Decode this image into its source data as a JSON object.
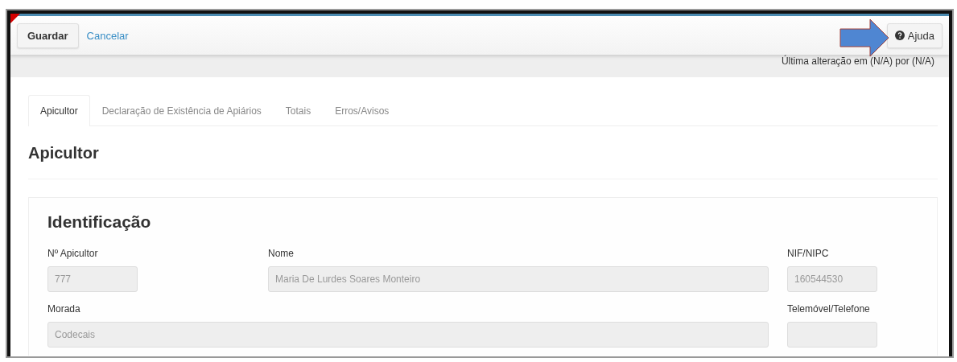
{
  "toolbar": {
    "buttons": [
      {
        "label": "Guardar",
        "kind": "button"
      },
      {
        "label": "Cancelar",
        "kind": "link"
      }
    ],
    "help": {
      "label": "Ajuda"
    }
  },
  "last_change": "Última alteração em (N/A) por (N/A)",
  "tabs": [
    {
      "label": "Apicultor",
      "selected": true
    },
    {
      "label": "Declaração de Existência de Apiários",
      "selected": false
    },
    {
      "label": "Totais",
      "selected": false
    },
    {
      "label": "Erros/Avisos",
      "selected": false
    }
  ],
  "page_title": "Apicultor",
  "section": {
    "title": "Identificação",
    "fields": [
      {
        "label": "Nº Apicultor",
        "value": "777",
        "disabled": true,
        "kind": "short"
      },
      {
        "label": "Nome",
        "value": "Maria De Lurdes Soares Monteiro",
        "disabled": true,
        "kind": "long"
      },
      {
        "label": "NIF/NIPC",
        "value": "160544530",
        "disabled": true,
        "kind": "short"
      },
      {
        "label": "Morada",
        "value": "Codecais",
        "disabled": true,
        "kind": "wide"
      },
      {
        "label": "Telemóvel/Telefone",
        "disabled": true,
        "kind": "short"
      }
    ]
  }
}
